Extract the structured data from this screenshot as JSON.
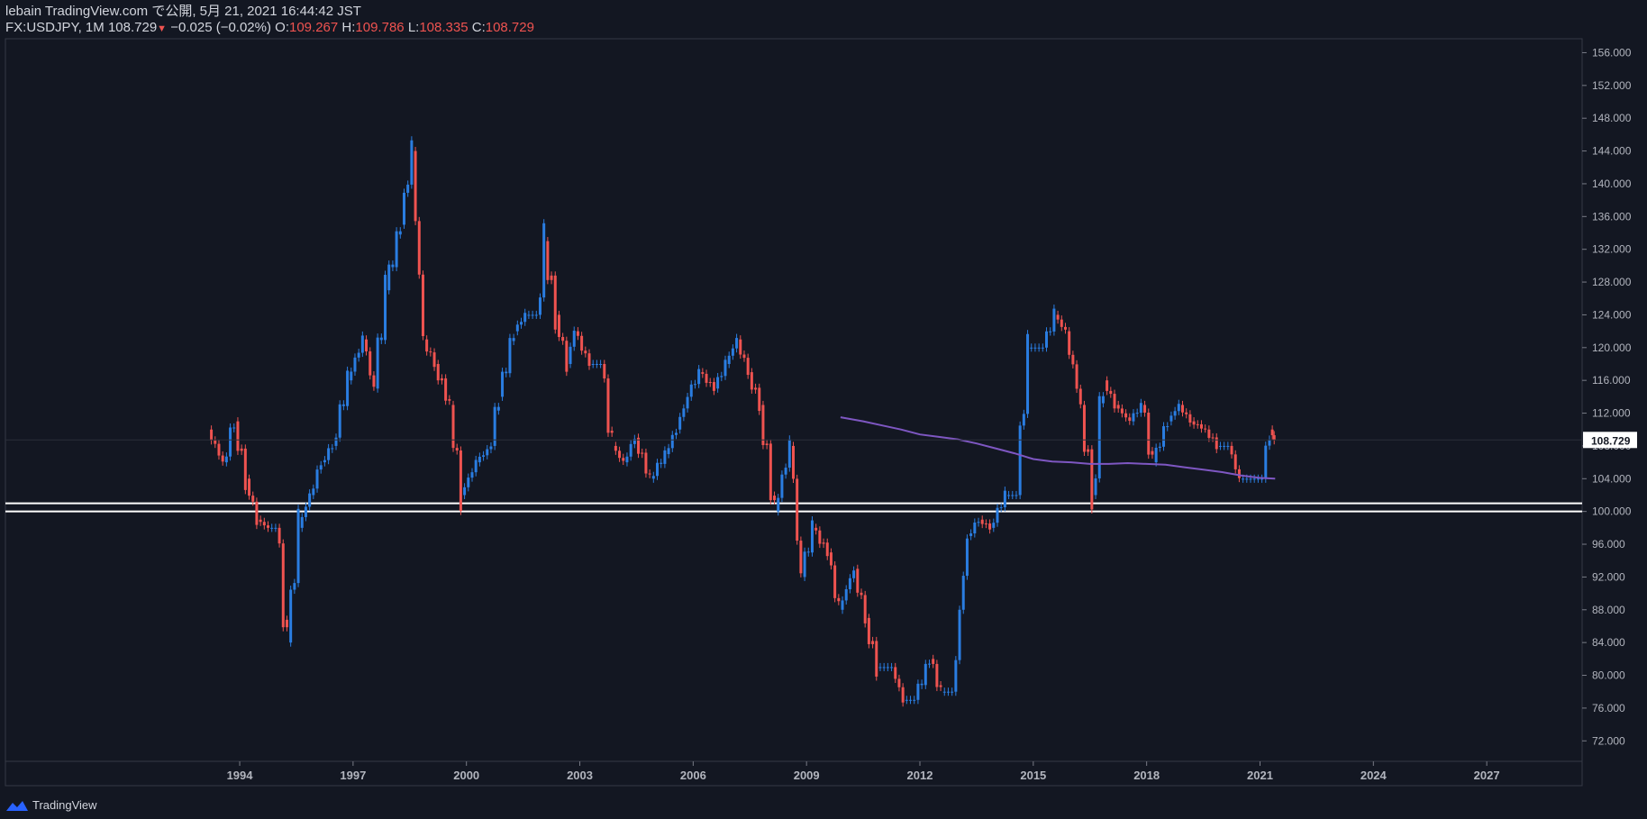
{
  "header": {
    "line1": "lebain TradingView.com で公開, 5月 21, 2021 16:44:42 JST",
    "symbol": "FX:USDJPY, 1M",
    "last": "108.729",
    "change": "−0.025 (−0.02%)",
    "o_label": "O:",
    "o_value": "109.267",
    "h_label": "H:",
    "h_value": "109.786",
    "l_label": "L:",
    "l_value": "108.335",
    "c_label": "C:",
    "c_value": "108.729"
  },
  "price_badge": "108.729",
  "footer": {
    "brand": "TradingView"
  },
  "colors": {
    "background": "#131722",
    "up": "#2a7de1",
    "down": "#ef5350",
    "ma": "#7e57c2",
    "level_line": "#ffffff",
    "badge": "#ffffff"
  },
  "chart_data": {
    "type": "candlestick",
    "x_axis": {
      "tick_labels": [
        "1994",
        "1997",
        "2000",
        "2003",
        "2006",
        "2009",
        "2012",
        "2015",
        "2018",
        "2021",
        "2024",
        "2027"
      ],
      "tick_years": [
        1994,
        1997,
        2000,
        2003,
        2006,
        2009,
        2012,
        2015,
        2018,
        2021,
        2024,
        2027
      ],
      "range": [
        1987.8,
        2029.5
      ]
    },
    "y_axis": {
      "tick_labels": [
        "72.000",
        "76.000",
        "80.000",
        "84.000",
        "88.000",
        "92.000",
        "96.000",
        "100.000",
        "104.000",
        "108.000",
        "112.000",
        "116.000",
        "120.000",
        "124.000",
        "128.000",
        "132.000",
        "136.000",
        "140.000",
        "144.000",
        "148.000",
        "152.000",
        "156.000"
      ],
      "tick_values": [
        72,
        76,
        80,
        84,
        88,
        92,
        96,
        100,
        104,
        108,
        112,
        116,
        120,
        124,
        128,
        132,
        136,
        140,
        144,
        148,
        152,
        156
      ],
      "range": [
        69.5,
        157.7
      ],
      "side": "right"
    },
    "horizontal_levels": [
      100,
      101
    ],
    "price_series": {
      "name": "USDJPY close (monthly, approx.)",
      "t": [
        1993.2,
        1993.6,
        1993.9,
        1994.2,
        1994.5,
        1994.8,
        1995.0,
        1995.3,
        1995.6,
        1995.9,
        1996.2,
        1996.5,
        1996.9,
        1997.3,
        1997.6,
        1997.9,
        1998.3,
        1998.6,
        1998.9,
        1999.2,
        1999.6,
        1999.9,
        2000.3,
        2000.7,
        2000.9,
        2001.3,
        2001.6,
        2001.9,
        2002.1,
        2002.4,
        2002.7,
        2002.9,
        2003.3,
        2003.6,
        2003.9,
        2004.2,
        2004.5,
        2004.9,
        2005.3,
        2005.6,
        2005.9,
        2006.2,
        2006.6,
        2006.9,
        2007.2,
        2007.5,
        2007.8,
        2008.2,
        2008.6,
        2008.9,
        2009.2,
        2009.6,
        2009.9,
        2010.3,
        2010.6,
        2010.9,
        2011.3,
        2011.6,
        2011.9,
        2012.3,
        2012.6,
        2012.9,
        2013.3,
        2013.6,
        2013.9,
        2014.3,
        2014.6,
        2014.9,
        2015.3,
        2015.6,
        2015.9,
        2016.3,
        2016.6,
        2016.9,
        2017.2,
        2017.6,
        2017.9,
        2018.2,
        2018.6,
        2018.9,
        2019.2,
        2019.6,
        2019.9,
        2020.2,
        2020.5,
        2020.9,
        2021.1,
        2021.3,
        2021.4
      ],
      "close": [
        110,
        106,
        111,
        104,
        99,
        98,
        98,
        84,
        98,
        102,
        106,
        108,
        116,
        121,
        115,
        127,
        135,
        144,
        121,
        118,
        113,
        102,
        106,
        108,
        114,
        122,
        124,
        124,
        133,
        124,
        118,
        122,
        118,
        118,
        108,
        106,
        109,
        104,
        107,
        110,
        114,
        117,
        115,
        118,
        121,
        117,
        113,
        100,
        108,
        92,
        98,
        95,
        88,
        93,
        87,
        81,
        81,
        77,
        77,
        82,
        78,
        78,
        97,
        99,
        98,
        102,
        102,
        120,
        120,
        124,
        122,
        113,
        102,
        116,
        113,
        111,
        113,
        106,
        111,
        113,
        111,
        110,
        108,
        108,
        104,
        104,
        104,
        110,
        108.7
      ]
    },
    "ma_series": {
      "name": "moving average",
      "t": [
        2009.9,
        2010.5,
        2011.0,
        2011.5,
        2012.0,
        2012.5,
        2013.0,
        2013.5,
        2014.0,
        2014.5,
        2015.0,
        2015.5,
        2016.0,
        2016.5,
        2017.0,
        2017.5,
        2018.0,
        2018.5,
        2019.0,
        2019.5,
        2020.0,
        2020.5,
        2021.0,
        2021.4
      ],
      "value": [
        111.5,
        111.0,
        110.5,
        110.0,
        109.4,
        109.1,
        108.8,
        108.3,
        107.7,
        107.1,
        106.4,
        106.1,
        106.0,
        105.8,
        105.8,
        105.9,
        105.8,
        105.7,
        105.4,
        105.1,
        104.8,
        104.4,
        104.1,
        104.0
      ]
    }
  }
}
